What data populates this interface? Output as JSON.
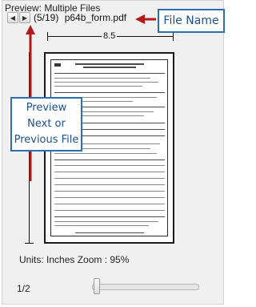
{
  "header": {
    "title": "Preview: Multiple Files"
  },
  "navigation": {
    "prev_icon": "triangle-left",
    "next_icon": "triangle-right"
  },
  "file": {
    "position": "(5/19)",
    "name": "p64b_form.pdf"
  },
  "annotations": {
    "file_name": "File Name",
    "preview_lines": [
      "Preview",
      "Next or",
      "Previous File"
    ],
    "color": "#2f6fb0",
    "arrow_color": "#b01a1a"
  },
  "dimensions": {
    "width_label": "8.5"
  },
  "status": {
    "text": "Units: Inches Zoom :  95%"
  },
  "pager": {
    "text": "1/2",
    "slider_fraction": 0.05
  }
}
